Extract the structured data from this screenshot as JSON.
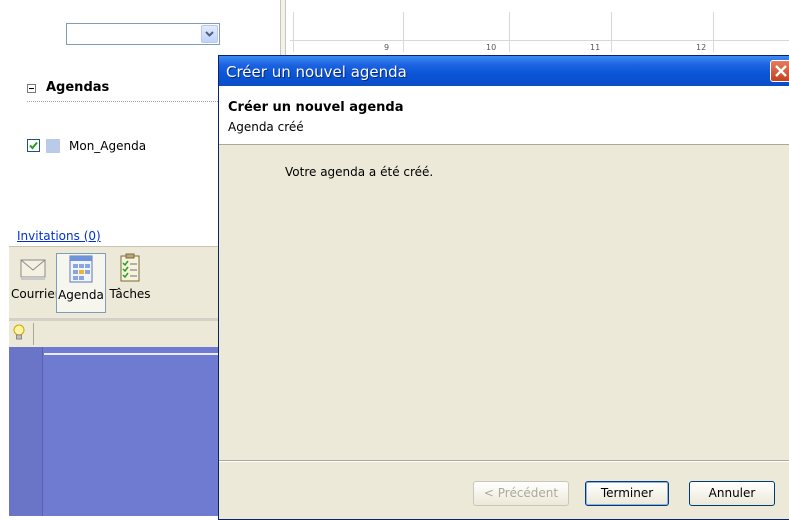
{
  "left_pane": {
    "calendars_section_title": "Agendas",
    "calendars": [
      {
        "name": "Mon_Agenda",
        "checked": true,
        "color": "#b9cbe8"
      }
    ],
    "invitations_link": "Invitations (0)",
    "nav": [
      {
        "label": "Courrier",
        "icon": "mail-icon",
        "selected": false
      },
      {
        "label": "Agenda",
        "icon": "calendar-icon",
        "selected": true
      },
      {
        "label": "Tâches",
        "icon": "tasks-icon",
        "selected": false
      }
    ]
  },
  "calendar_view": {
    "day_numbers": [
      "9",
      "10",
      "11",
      "12"
    ]
  },
  "dialog": {
    "window_title": "Créer un nouvel agenda",
    "header_title": "Créer un nouvel agenda",
    "header_subtitle": "Agenda créé",
    "message": "Votre agenda a été créé.",
    "buttons": {
      "previous": "< Précédent",
      "finish": "Terminer",
      "cancel": "Annuler"
    }
  },
  "colors": {
    "titlebar_blue": "#0a55d8",
    "dialog_face": "#ece9d8",
    "sidebar_blue": "#6f7bd0",
    "link_blue": "#0033cc"
  }
}
